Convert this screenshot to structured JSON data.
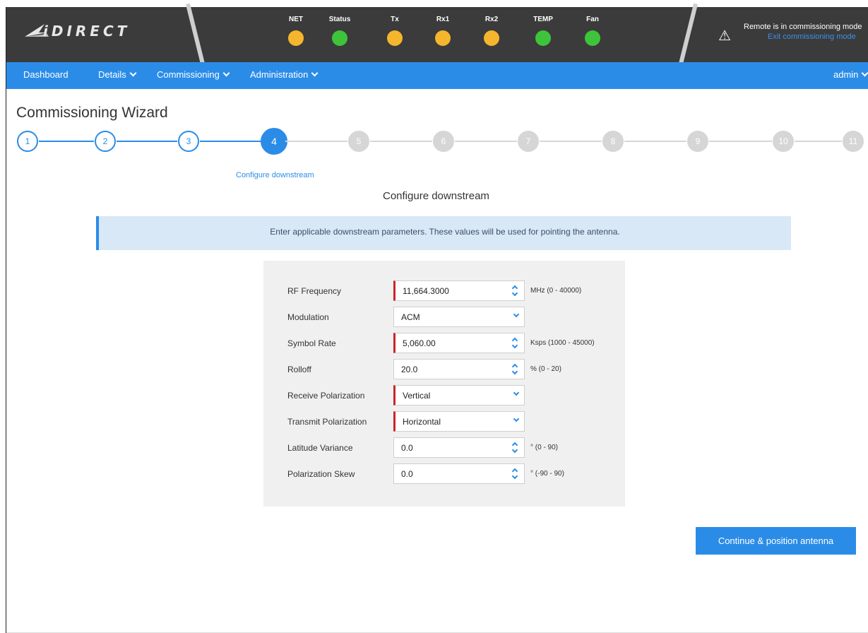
{
  "header": {
    "logo_text": "iDIRECT",
    "indicators": [
      {
        "label": "NET",
        "color": "#f5b62e"
      },
      {
        "label": "Status",
        "color": "#3ec43a"
      },
      {
        "label": "Tx",
        "color": "#f5b62e"
      },
      {
        "label": "Rx1",
        "color": "#f5b62e"
      },
      {
        "label": "Rx2",
        "color": "#f5b62e"
      },
      {
        "label": "TEMP",
        "color": "#3ec43a"
      },
      {
        "label": "Fan",
        "color": "#3ec43a"
      }
    ],
    "alert_text": "Remote is in commissioning mode",
    "alert_link": "Exit commissioning mode",
    "alert_icon": "warning-triangle-icon"
  },
  "nav": {
    "dashboard": "Dashboard",
    "details": "Details",
    "commissioning": "Commissioning",
    "administration": "Administration",
    "user": "admin"
  },
  "wizard": {
    "title": "Commissioning Wizard",
    "steps": [
      "1",
      "2",
      "3",
      "4",
      "5",
      "6",
      "7",
      "8",
      "9",
      "10",
      "11"
    ],
    "current_step": 4,
    "step_caption": "Configure downstream",
    "section_title": "Configure downstream",
    "info": "Enter applicable downstream parameters. These values will be used for pointing the antenna.",
    "fields": [
      {
        "label": "RF Frequency",
        "value": "11,664.3000",
        "unit": "MHz (0 - 40000)",
        "required": true,
        "kind": "spinner"
      },
      {
        "label": "Modulation",
        "value": "ACM",
        "unit": "",
        "required": false,
        "kind": "select"
      },
      {
        "label": "Symbol Rate",
        "value": "5,060.00",
        "unit": "Ksps (1000 - 45000)",
        "required": true,
        "kind": "spinner"
      },
      {
        "label": "Rolloff",
        "value": "20.0",
        "unit": "% (0 - 20)",
        "required": false,
        "kind": "spinner"
      },
      {
        "label": "Receive Polarization",
        "value": "Vertical",
        "unit": "",
        "required": true,
        "kind": "select"
      },
      {
        "label": "Transmit Polarization",
        "value": "Horizontal",
        "unit": "",
        "required": true,
        "kind": "select"
      },
      {
        "label": "Latitude Variance",
        "value": "0.0",
        "unit": "° (0 - 90)",
        "required": false,
        "kind": "spinner"
      },
      {
        "label": "Polarization Skew",
        "value": "0.0",
        "unit": "° (-90 - 90)",
        "required": false,
        "kind": "spinner"
      }
    ],
    "continue_label": "Continue & position antenna"
  },
  "colors": {
    "accent": "#2b8ce8",
    "required": "#c8262b",
    "pending": "#d6d6d6"
  }
}
